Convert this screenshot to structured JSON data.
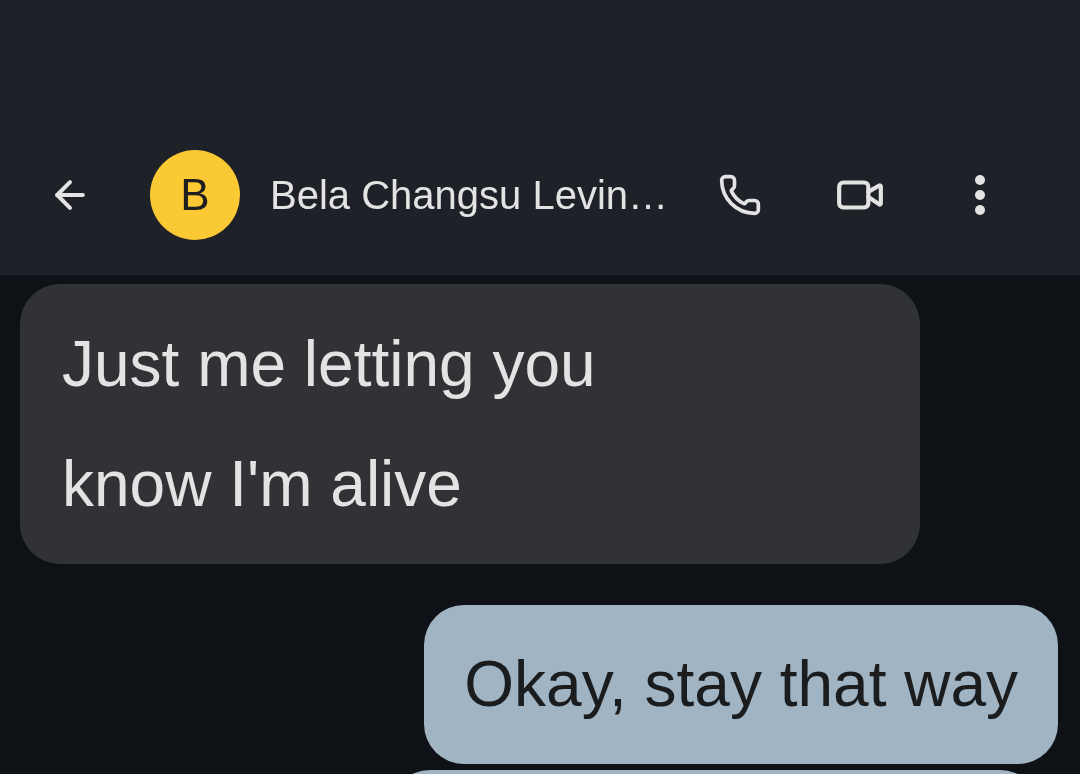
{
  "header": {
    "contact": {
      "initial": "B",
      "name": "Bela Changsu Levin…",
      "color": "#fbc933"
    }
  },
  "messages": [
    {
      "kind": "incoming",
      "text": "Just me letting you know I'm alive"
    },
    {
      "kind": "outgoing",
      "text": "Okay, stay that way"
    }
  ]
}
